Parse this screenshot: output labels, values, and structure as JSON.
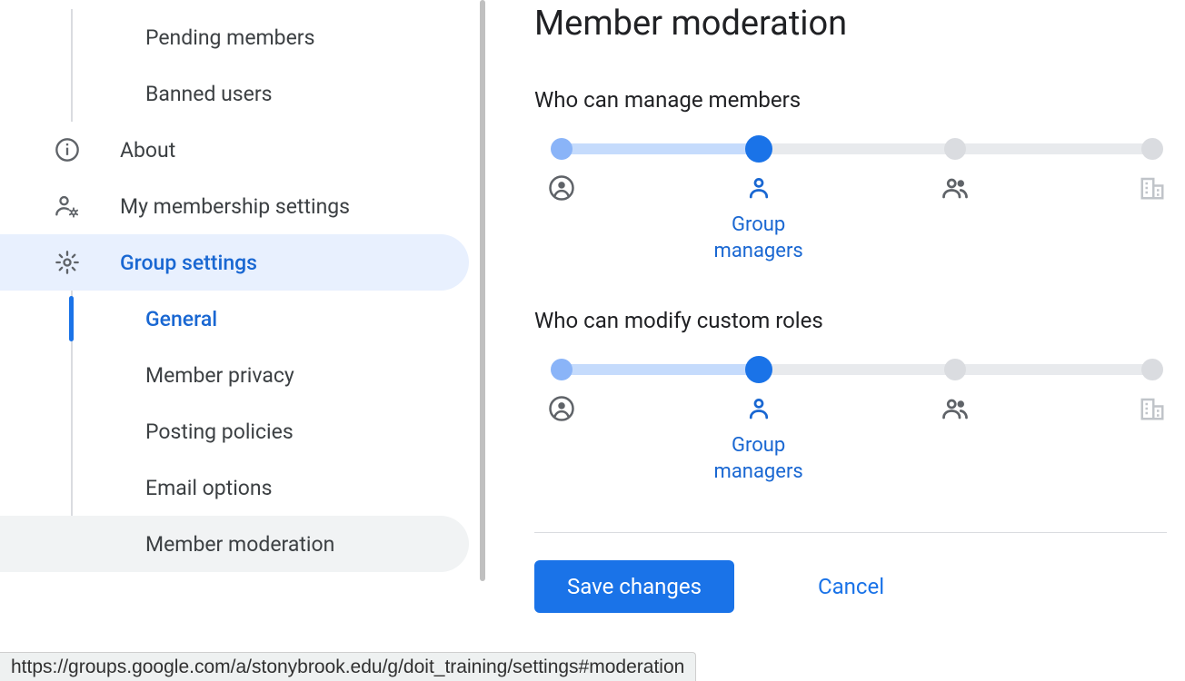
{
  "sidebar": {
    "sub_top": {
      "pending": "Pending members",
      "banned": "Banned users"
    },
    "about": "About",
    "membership": "My membership settings",
    "group_settings": "Group settings",
    "gs_sub": {
      "general": "General",
      "member_privacy": "Member privacy",
      "posting_policies": "Posting policies",
      "email_options": "Email options",
      "member_moderation": "Member moderation"
    }
  },
  "main": {
    "title": "Member moderation",
    "sections": {
      "manage": {
        "title": "Who can manage members",
        "selected_label": "Group managers",
        "selected_index": 1,
        "stops": 4
      },
      "roles": {
        "title": "Who can modify custom roles",
        "selected_label": "Group managers",
        "selected_index": 1,
        "stops": 4
      }
    },
    "buttons": {
      "save": "Save changes",
      "cancel": "Cancel"
    }
  },
  "statusbar": "https://groups.google.com/a/stonybrook.edu/g/doit_training/settings#moderation"
}
